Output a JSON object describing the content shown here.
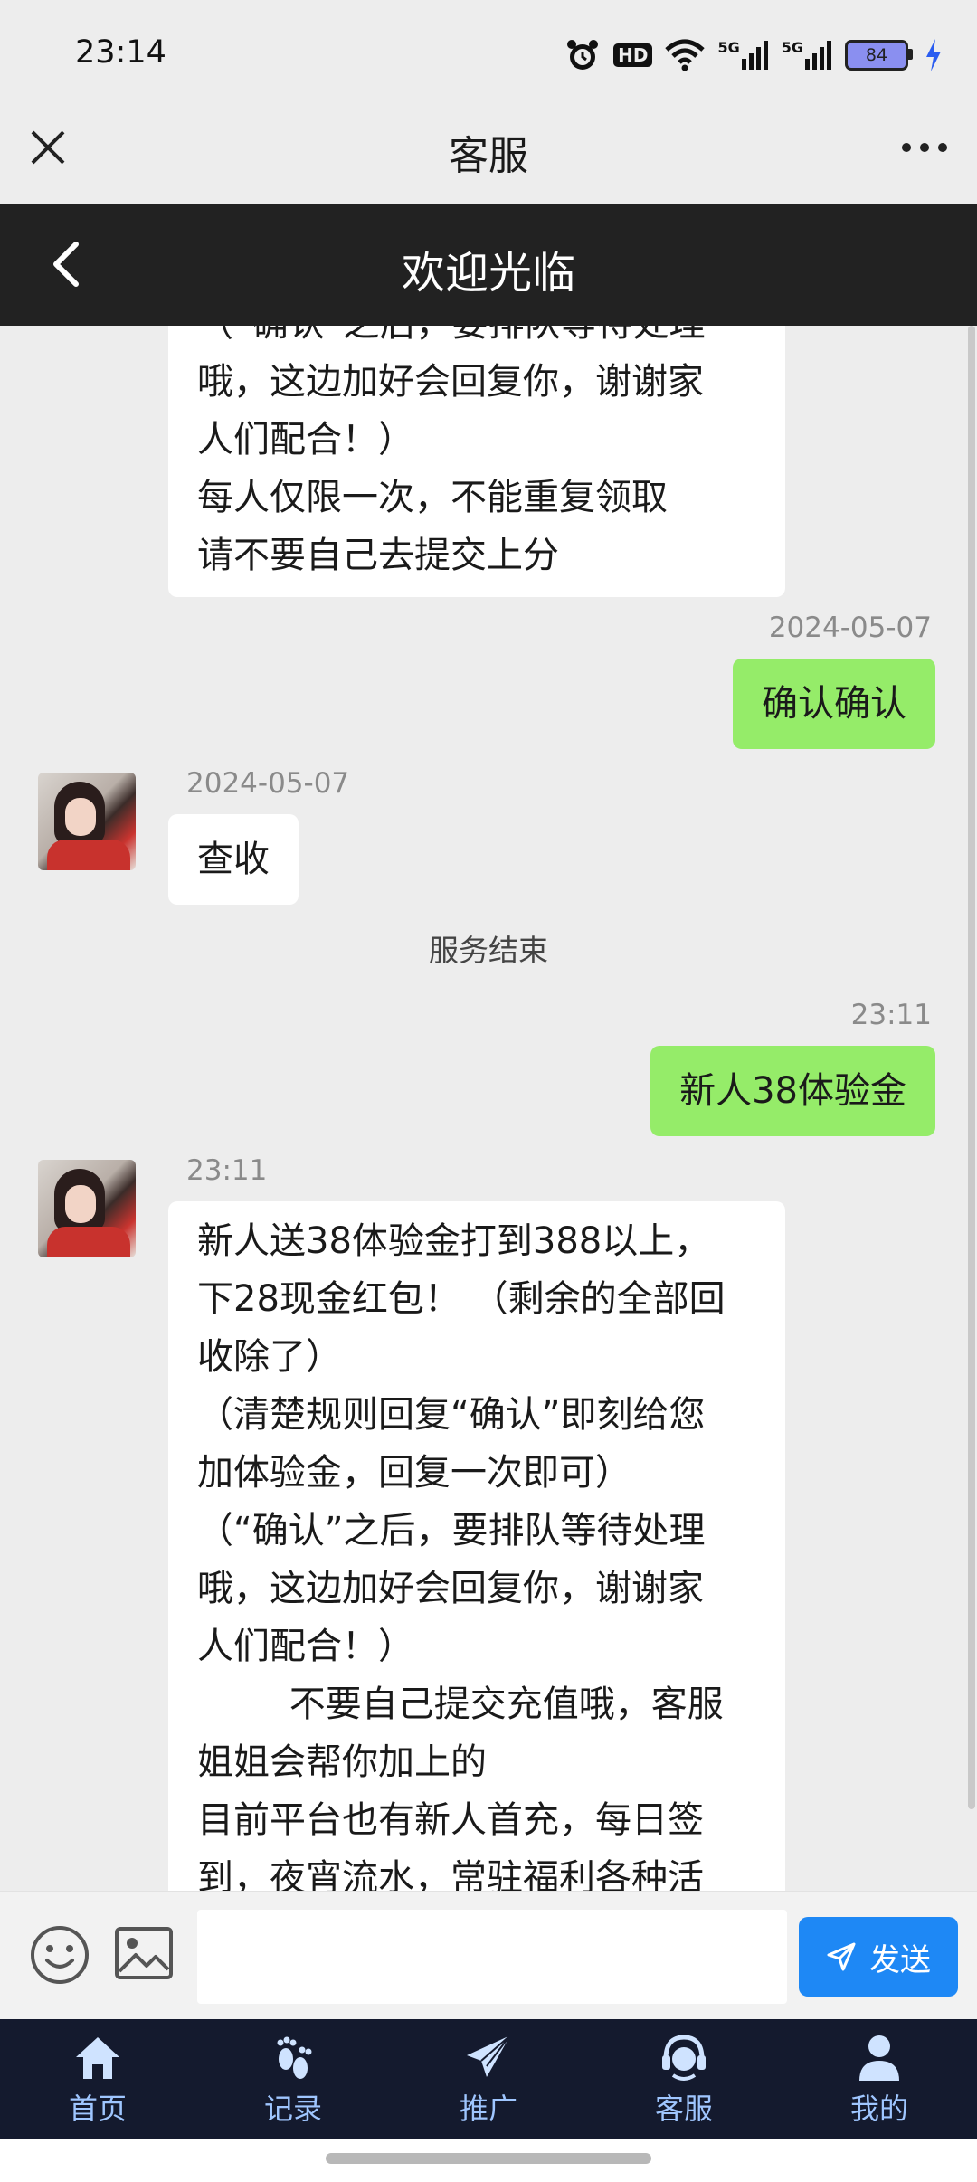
{
  "status_bar": {
    "time": "23:14",
    "battery": "84",
    "signal_1": "5G",
    "signal_2": "5G",
    "hd": "HD"
  },
  "header": {
    "title": "客服"
  },
  "subheader": {
    "title": "欢迎光临"
  },
  "messages": {
    "m1": {
      "side": "in",
      "lines": [
        "（“确认”之后，要排队等待处理",
        "哦，这边加好会回复你，谢谢家",
        "人们配合！）",
        "每人仅限一次，不能重复领取",
        "请不要自己去提交上分"
      ]
    },
    "m2": {
      "side": "out",
      "time": "2024-05-07",
      "text": "确认确认"
    },
    "m3": {
      "side": "in",
      "time": "2024-05-07",
      "text": "查收"
    },
    "system": "服务结束",
    "m4": {
      "side": "out",
      "time": "23:11",
      "text": "新人38体验金"
    },
    "m5": {
      "side": "in",
      "time": "23:11",
      "lines": [
        "新人送38体验金打到388以上，",
        "下28现金红包！ （剩余的全部回",
        "收除了）",
        "（清楚规则回复“确认”即刻给您",
        "加体验金，回复一次即可）",
        "（“确认”之后，要排队等待处理",
        "哦，这边加好会回复你，谢谢家",
        "人们配合！）",
        "        不要自己提交充值哦，客服",
        "姐姐会帮你加上的",
        "目前平台也有新人首充，每日签",
        "到，夜宵流水，常驻福利各种活"
      ]
    }
  },
  "input": {
    "placeholder": "",
    "send_label": "发送"
  },
  "nav": {
    "items": [
      {
        "label": "首页",
        "icon": "home-icon"
      },
      {
        "label": "记录",
        "icon": "footprint-icon"
      },
      {
        "label": "推广",
        "icon": "paper-plane-icon"
      },
      {
        "label": "客服",
        "icon": "headset-icon"
      },
      {
        "label": "我的",
        "icon": "user-icon"
      }
    ]
  },
  "colors": {
    "accent": "#1e88f5",
    "out_bubble": "#95ec69",
    "nav_bg": "#141a2e",
    "nav_text": "#9fc6ff"
  }
}
